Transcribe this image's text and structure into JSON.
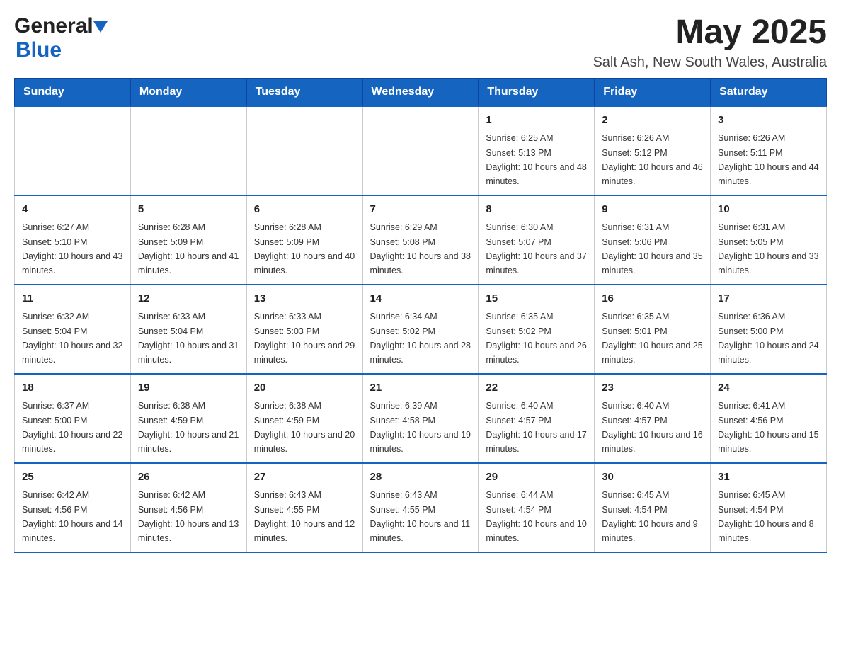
{
  "header": {
    "logo_general": "General",
    "logo_blue": "Blue",
    "month_year": "May 2025",
    "location": "Salt Ash, New South Wales, Australia"
  },
  "days_of_week": [
    "Sunday",
    "Monday",
    "Tuesday",
    "Wednesday",
    "Thursday",
    "Friday",
    "Saturday"
  ],
  "weeks": [
    [
      {
        "day": "",
        "info": ""
      },
      {
        "day": "",
        "info": ""
      },
      {
        "day": "",
        "info": ""
      },
      {
        "day": "",
        "info": ""
      },
      {
        "day": "1",
        "info": "Sunrise: 6:25 AM\nSunset: 5:13 PM\nDaylight: 10 hours and 48 minutes."
      },
      {
        "day": "2",
        "info": "Sunrise: 6:26 AM\nSunset: 5:12 PM\nDaylight: 10 hours and 46 minutes."
      },
      {
        "day": "3",
        "info": "Sunrise: 6:26 AM\nSunset: 5:11 PM\nDaylight: 10 hours and 44 minutes."
      }
    ],
    [
      {
        "day": "4",
        "info": "Sunrise: 6:27 AM\nSunset: 5:10 PM\nDaylight: 10 hours and 43 minutes."
      },
      {
        "day": "5",
        "info": "Sunrise: 6:28 AM\nSunset: 5:09 PM\nDaylight: 10 hours and 41 minutes."
      },
      {
        "day": "6",
        "info": "Sunrise: 6:28 AM\nSunset: 5:09 PM\nDaylight: 10 hours and 40 minutes."
      },
      {
        "day": "7",
        "info": "Sunrise: 6:29 AM\nSunset: 5:08 PM\nDaylight: 10 hours and 38 minutes."
      },
      {
        "day": "8",
        "info": "Sunrise: 6:30 AM\nSunset: 5:07 PM\nDaylight: 10 hours and 37 minutes."
      },
      {
        "day": "9",
        "info": "Sunrise: 6:31 AM\nSunset: 5:06 PM\nDaylight: 10 hours and 35 minutes."
      },
      {
        "day": "10",
        "info": "Sunrise: 6:31 AM\nSunset: 5:05 PM\nDaylight: 10 hours and 33 minutes."
      }
    ],
    [
      {
        "day": "11",
        "info": "Sunrise: 6:32 AM\nSunset: 5:04 PM\nDaylight: 10 hours and 32 minutes."
      },
      {
        "day": "12",
        "info": "Sunrise: 6:33 AM\nSunset: 5:04 PM\nDaylight: 10 hours and 31 minutes."
      },
      {
        "day": "13",
        "info": "Sunrise: 6:33 AM\nSunset: 5:03 PM\nDaylight: 10 hours and 29 minutes."
      },
      {
        "day": "14",
        "info": "Sunrise: 6:34 AM\nSunset: 5:02 PM\nDaylight: 10 hours and 28 minutes."
      },
      {
        "day": "15",
        "info": "Sunrise: 6:35 AM\nSunset: 5:02 PM\nDaylight: 10 hours and 26 minutes."
      },
      {
        "day": "16",
        "info": "Sunrise: 6:35 AM\nSunset: 5:01 PM\nDaylight: 10 hours and 25 minutes."
      },
      {
        "day": "17",
        "info": "Sunrise: 6:36 AM\nSunset: 5:00 PM\nDaylight: 10 hours and 24 minutes."
      }
    ],
    [
      {
        "day": "18",
        "info": "Sunrise: 6:37 AM\nSunset: 5:00 PM\nDaylight: 10 hours and 22 minutes."
      },
      {
        "day": "19",
        "info": "Sunrise: 6:38 AM\nSunset: 4:59 PM\nDaylight: 10 hours and 21 minutes."
      },
      {
        "day": "20",
        "info": "Sunrise: 6:38 AM\nSunset: 4:59 PM\nDaylight: 10 hours and 20 minutes."
      },
      {
        "day": "21",
        "info": "Sunrise: 6:39 AM\nSunset: 4:58 PM\nDaylight: 10 hours and 19 minutes."
      },
      {
        "day": "22",
        "info": "Sunrise: 6:40 AM\nSunset: 4:57 PM\nDaylight: 10 hours and 17 minutes."
      },
      {
        "day": "23",
        "info": "Sunrise: 6:40 AM\nSunset: 4:57 PM\nDaylight: 10 hours and 16 minutes."
      },
      {
        "day": "24",
        "info": "Sunrise: 6:41 AM\nSunset: 4:56 PM\nDaylight: 10 hours and 15 minutes."
      }
    ],
    [
      {
        "day": "25",
        "info": "Sunrise: 6:42 AM\nSunset: 4:56 PM\nDaylight: 10 hours and 14 minutes."
      },
      {
        "day": "26",
        "info": "Sunrise: 6:42 AM\nSunset: 4:56 PM\nDaylight: 10 hours and 13 minutes."
      },
      {
        "day": "27",
        "info": "Sunrise: 6:43 AM\nSunset: 4:55 PM\nDaylight: 10 hours and 12 minutes."
      },
      {
        "day": "28",
        "info": "Sunrise: 6:43 AM\nSunset: 4:55 PM\nDaylight: 10 hours and 11 minutes."
      },
      {
        "day": "29",
        "info": "Sunrise: 6:44 AM\nSunset: 4:54 PM\nDaylight: 10 hours and 10 minutes."
      },
      {
        "day": "30",
        "info": "Sunrise: 6:45 AM\nSunset: 4:54 PM\nDaylight: 10 hours and 9 minutes."
      },
      {
        "day": "31",
        "info": "Sunrise: 6:45 AM\nSunset: 4:54 PM\nDaylight: 10 hours and 8 minutes."
      }
    ]
  ]
}
